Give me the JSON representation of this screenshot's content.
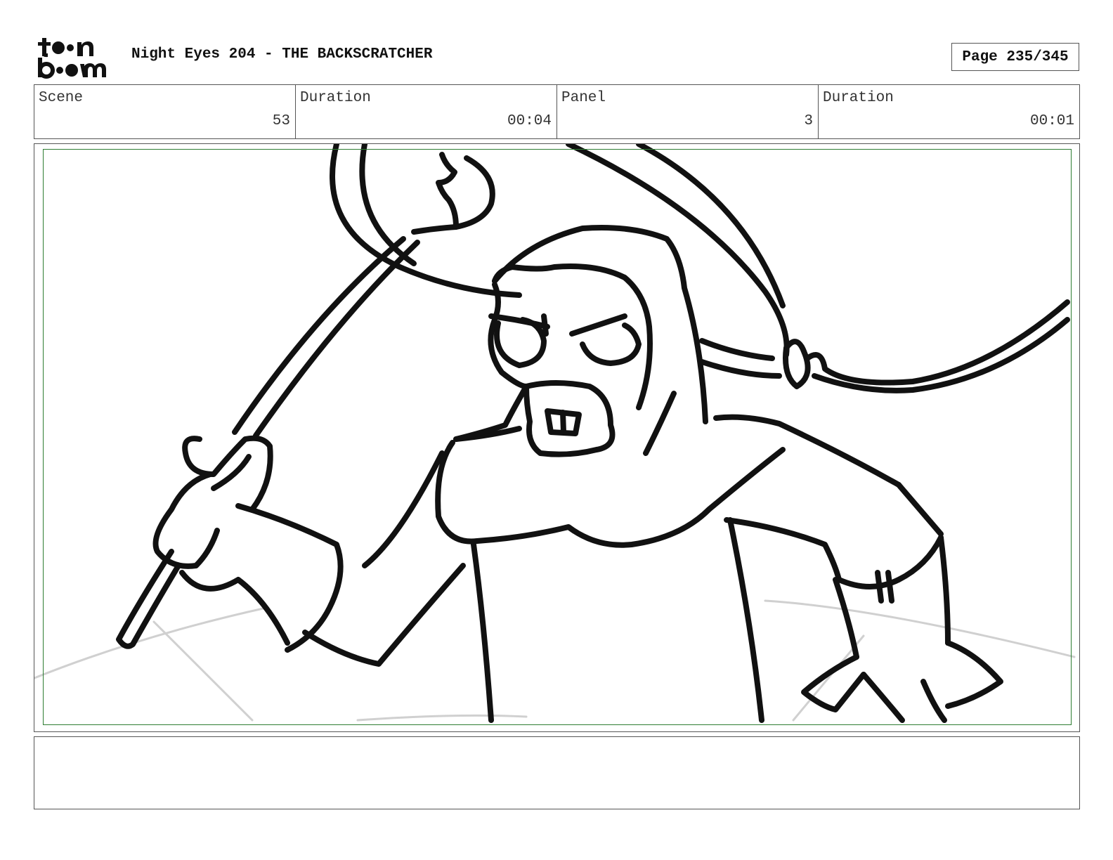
{
  "header": {
    "logo_top": "toon",
    "logo_bottom": "boom",
    "title": "Night Eyes 204 - THE BACKSCRATCHER",
    "page_label": "Page 235/345"
  },
  "info": {
    "scene_label": "Scene",
    "scene_value": "53",
    "scene_duration_label": "Duration",
    "scene_duration_value": "00:04",
    "panel_label": "Panel",
    "panel_value": "3",
    "panel_duration_label": "Duration",
    "panel_duration_value": "00:01"
  },
  "panel": {
    "safe_area_color": "#2e7d32",
    "drawing": "rough storyboard sketch: character swinging a backscratcher"
  },
  "notes": {
    "text": ""
  }
}
